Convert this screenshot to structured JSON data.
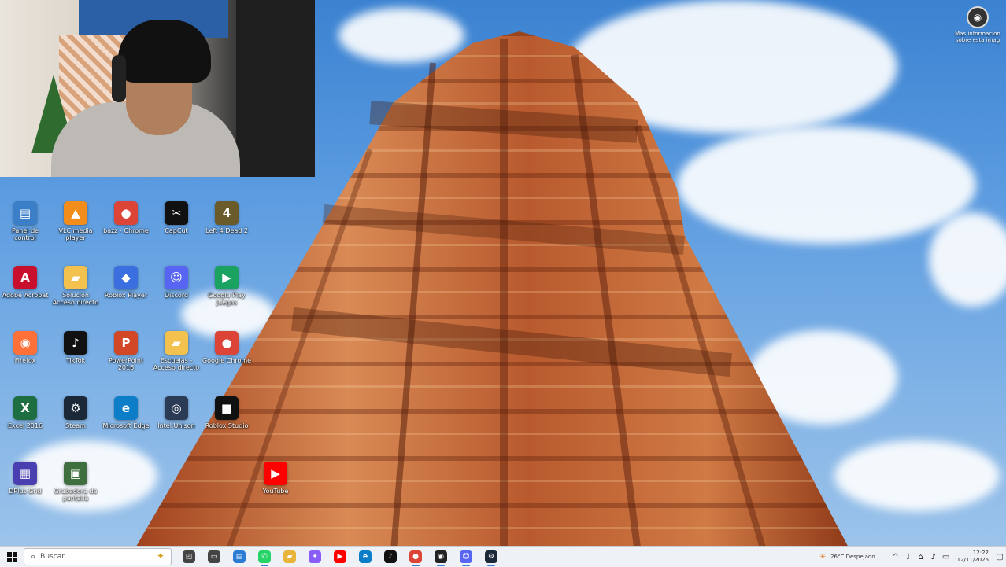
{
  "webcam": {
    "label": "webcam-overlay"
  },
  "notification": {
    "text": "Más información sobre esta imag"
  },
  "desktop_icons": [
    {
      "label": "Panel de control",
      "icon": "control-panel-icon",
      "color": "#3a7fc7",
      "glyph": "▤"
    },
    {
      "label": "VLC media player",
      "icon": "vlc-icon",
      "color": "#f28c1b",
      "glyph": "▲"
    },
    {
      "label": "bazz - Chrome",
      "icon": "chrome-icon",
      "color": "#db4437",
      "glyph": "●"
    },
    {
      "label": "CapCut",
      "icon": "capcut-icon",
      "color": "#111111",
      "glyph": "✂"
    },
    {
      "label": "Left 4 Dead 2",
      "icon": "left4dead-icon",
      "color": "#6b5a2a",
      "glyph": "4"
    },
    {
      "label": "Adobe Acrobat",
      "icon": "acrobat-icon",
      "color": "#c8102e",
      "glyph": "A"
    },
    {
      "label": "Solución Acceso directo",
      "icon": "folder-icon",
      "color": "#f2c14e",
      "glyph": "▰"
    },
    {
      "label": "Roblox Player",
      "icon": "roblox-icon",
      "color": "#3b6fe0",
      "glyph": "◆"
    },
    {
      "label": "Discord",
      "icon": "discord-icon",
      "color": "#5865f2",
      "glyph": "☺"
    },
    {
      "label": "Google Play Juegos",
      "icon": "play-games-icon",
      "color": "#1aa260",
      "glyph": "▶"
    },
    {
      "label": "Firefox",
      "icon": "firefox-icon",
      "color": "#ff7139",
      "glyph": "◉"
    },
    {
      "label": "TikTok",
      "icon": "tiktok-icon",
      "color": "#111111",
      "glyph": "♪"
    },
    {
      "label": "PowerPoint 2016",
      "icon": "powerpoint-icon",
      "color": "#d24726",
      "glyph": "P"
    },
    {
      "label": "Escuelas - Acceso directo",
      "icon": "folder-icon",
      "color": "#f2c14e",
      "glyph": "▰"
    },
    {
      "label": "Google Chrome",
      "icon": "chrome-icon",
      "color": "#db4437",
      "glyph": "●"
    },
    {
      "label": "Excel 2016",
      "icon": "excel-icon",
      "color": "#1d6f42",
      "glyph": "X"
    },
    {
      "label": "Steam",
      "icon": "steam-icon",
      "color": "#1b2838",
      "glyph": "⚙"
    },
    {
      "label": "Microsoft Edge",
      "icon": "edge-icon",
      "color": "#0c7ec8",
      "glyph": "e"
    },
    {
      "label": "Intel Unison",
      "icon": "unison-icon",
      "color": "#2b3a55",
      "glyph": "◎"
    },
    {
      "label": "Roblox Studio",
      "icon": "roblox-studio-icon",
      "color": "#111111",
      "glyph": "■"
    },
    {
      "label": "DPlus Grid",
      "icon": "dplus-icon",
      "color": "#4a3fb0",
      "glyph": "▦"
    },
    {
      "label": "Grabadora de pantalla",
      "icon": "screen-recorder-icon",
      "color": "#3f6e3f",
      "glyph": "▣"
    },
    {
      "label": "YouTube",
      "icon": "youtube-icon",
      "color": "#ff0000",
      "glyph": "▶"
    }
  ],
  "taskbar": {
    "search_placeholder": "Buscar",
    "apps": [
      {
        "icon": "task-view-icon",
        "color": "#444444",
        "glyph": "◰",
        "active": false
      },
      {
        "icon": "widgets-icon",
        "color": "#444444",
        "glyph": "▭",
        "active": false
      },
      {
        "icon": "store-icon",
        "color": "#2b7cd3",
        "glyph": "▤",
        "active": false
      },
      {
        "icon": "whatsapp-icon",
        "color": "#25d366",
        "glyph": "✆",
        "active": true
      },
      {
        "icon": "file-explorer-icon",
        "color": "#e9b43a",
        "glyph": "▰",
        "active": false
      },
      {
        "icon": "copilot-icon",
        "color": "#8a5cf6",
        "glyph": "✦",
        "active": false
      },
      {
        "icon": "youtube-icon",
        "color": "#ff0000",
        "glyph": "▶",
        "active": false
      },
      {
        "icon": "edge-icon",
        "color": "#0c7ec8",
        "glyph": "e",
        "active": false
      },
      {
        "icon": "tiktok-icon",
        "color": "#111111",
        "glyph": "♪",
        "active": false
      },
      {
        "icon": "chrome-icon",
        "color": "#db4437",
        "glyph": "●",
        "active": true
      },
      {
        "icon": "obs-icon",
        "color": "#222222",
        "glyph": "◉",
        "active": true
      },
      {
        "icon": "discord-icon",
        "color": "#5865f2",
        "glyph": "☺",
        "active": true
      },
      {
        "icon": "steam-icon",
        "color": "#1b2838",
        "glyph": "⚙",
        "active": true
      }
    ],
    "weather": "26°C  Despejado",
    "time": "12:22",
    "date": "12/11/2026"
  }
}
